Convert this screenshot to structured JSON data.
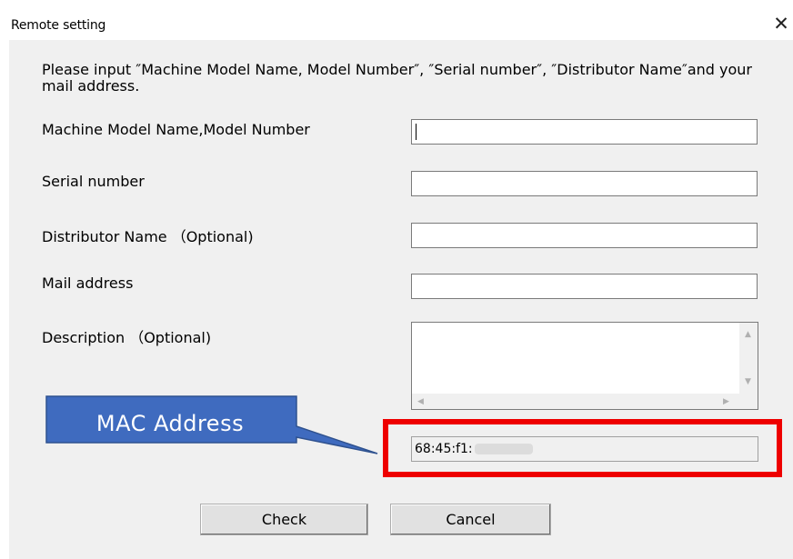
{
  "window": {
    "title": "Remote setting",
    "close_glyph": "✕"
  },
  "intro_text": "Please input ″Machine Model Name, Model Number″, ″Serial number″, ″Distributor Name″and your mail address.",
  "fields": {
    "model": {
      "label": "Machine Model Name,Model Number",
      "value": ""
    },
    "serial": {
      "label": "Serial number",
      "value": ""
    },
    "distributor": {
      "label": "Distributor Name （Optional)",
      "value": ""
    },
    "mail": {
      "label": "Mail address",
      "value": ""
    },
    "description": {
      "label": "Description （Optional)",
      "value": ""
    }
  },
  "mac": {
    "value": "68:45:f1:",
    "callout_label": "MAC Address"
  },
  "buttons": {
    "check": "Check",
    "cancel": "Cancel"
  },
  "colors": {
    "highlight": "#ee0000",
    "callout_fill": "#3f6bbf"
  }
}
